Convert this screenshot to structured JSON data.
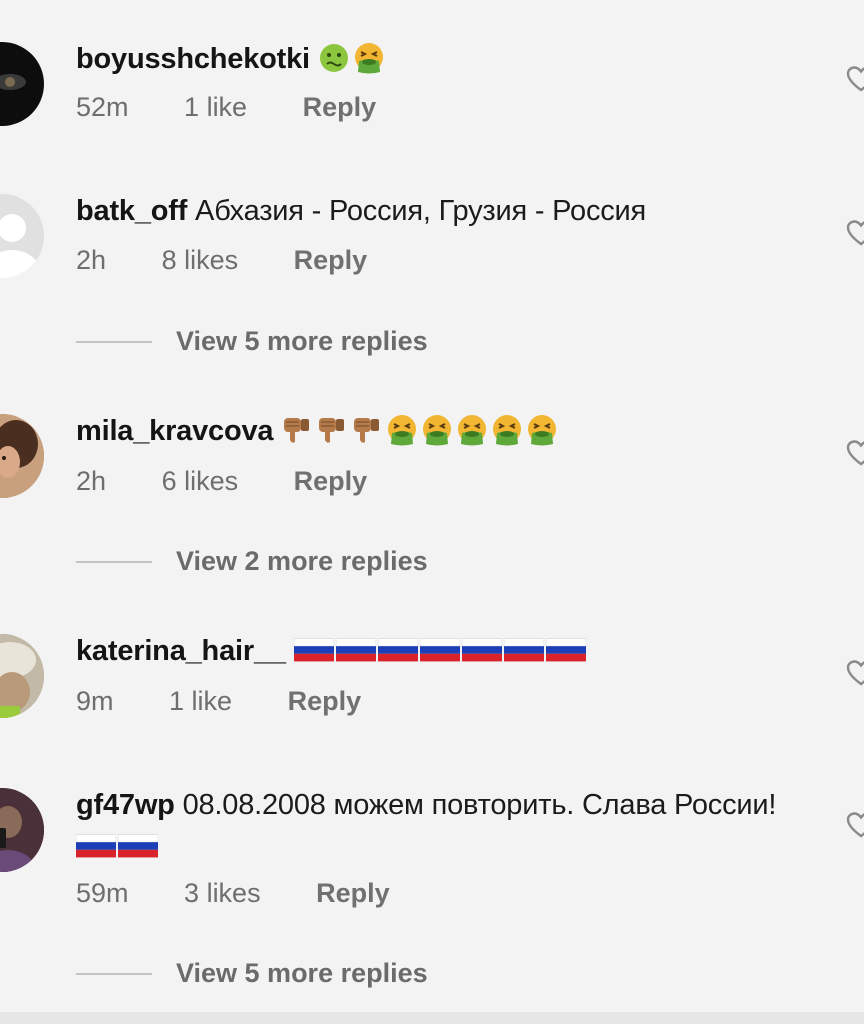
{
  "comments": [
    {
      "username": "boyusshchekotki",
      "text": "",
      "emoji": [
        "nauseated-face-icon",
        "vomiting-face-icon"
      ],
      "time": "52m",
      "likes": "1 like",
      "reply": "Reply"
    },
    {
      "username": "batk_off",
      "text": "Абхазия - Россия, Грузия - Россия",
      "time": "2h",
      "likes": "8 likes",
      "reply": "Reply",
      "more_replies": "View 5 more replies"
    },
    {
      "username": "mila_kravcova",
      "text": "",
      "emoji": [
        "thumbs-down-icon",
        "thumbs-down-icon",
        "thumbs-down-icon",
        "vomiting-face-icon",
        "vomiting-face-icon",
        "vomiting-face-icon",
        "vomiting-face-icon",
        "vomiting-face-icon"
      ],
      "time": "2h",
      "likes": "6 likes",
      "reply": "Reply",
      "more_replies": "View 2 more replies"
    },
    {
      "username": "katerina_hair__",
      "text": "",
      "emoji": [
        "russia-flag-icon",
        "russia-flag-icon",
        "russia-flag-icon",
        "russia-flag-icon",
        "russia-flag-icon",
        "russia-flag-icon",
        "russia-flag-icon"
      ],
      "time": "9m",
      "likes": "1 like",
      "reply": "Reply"
    },
    {
      "username": "gf47wp",
      "text": "08.08.2008 можем повторить. Слава России!",
      "emoji": [
        "russia-flag-icon",
        "russia-flag-icon"
      ],
      "time": "59m",
      "likes": "3 likes",
      "reply": "Reply",
      "more_replies": "View 5 more replies"
    }
  ],
  "colors": {
    "background": "#f3f3f3",
    "username": "#151515",
    "meta": "#6e6e6e",
    "flag_white": "#ffffff",
    "flag_blue": "#1c3fb8",
    "flag_red": "#d8232a"
  }
}
